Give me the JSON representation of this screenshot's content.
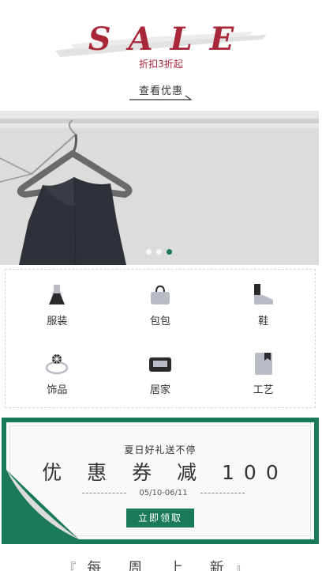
{
  "sale": {
    "title": "SALE",
    "subtitle": "折扣3折起",
    "view_button": "查看优惠",
    "accent_color": "#a8283a"
  },
  "banner": {
    "image": "black-dress-on-hanger",
    "dots": 3,
    "active_dot": 3,
    "active_color": "#1d7a56"
  },
  "categories": [
    {
      "label": "服装",
      "icon": "dress-icon"
    },
    {
      "label": "包包",
      "icon": "handbag-icon"
    },
    {
      "label": "鞋",
      "icon": "shoe-icon"
    },
    {
      "label": "饰品",
      "icon": "ring-icon"
    },
    {
      "label": "居家",
      "icon": "sofa-icon"
    },
    {
      "label": "工艺",
      "icon": "book-icon"
    }
  ],
  "coupon": {
    "tagline": "夏日好礼送不停",
    "title": "优 惠 券 减 100",
    "dates": "05/10-06/11",
    "button": "立即领取",
    "brand_color": "#1a7956"
  },
  "weekly": {
    "title": "每 周 上 新",
    "open_bracket": "『",
    "close_bracket": "』"
  }
}
